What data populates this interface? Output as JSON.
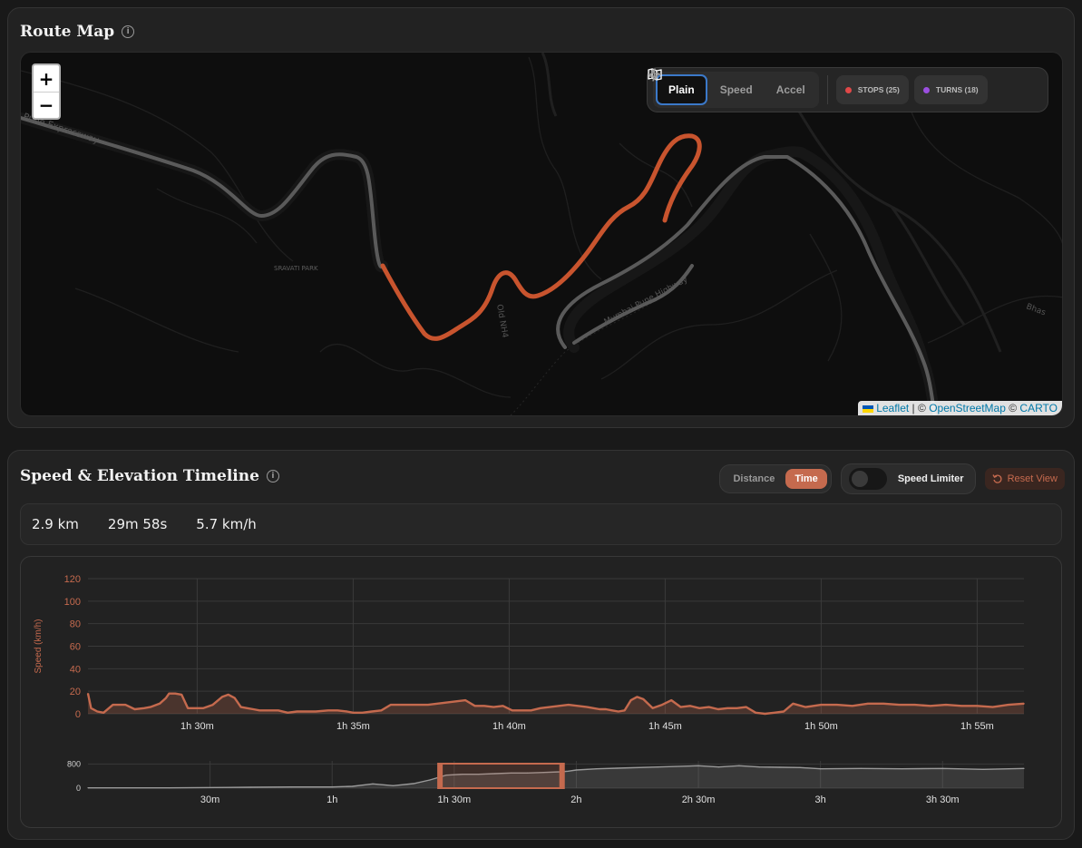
{
  "route_map": {
    "title": "Route Map",
    "info_icon": "info-icon",
    "zoom_in": "+",
    "zoom_out": "−",
    "modes": [
      {
        "label": "Plain",
        "icon": "map-icon",
        "active": true
      },
      {
        "label": "Speed",
        "icon": "lightning-icon",
        "active": false
      },
      {
        "label": "Accel",
        "icon": "activity-icon",
        "active": false
      }
    ],
    "overlays": [
      {
        "label": "STOPS (25)",
        "color": "#e04848"
      },
      {
        "label": "TURNS (18)",
        "color": "#9b4fe0"
      }
    ],
    "map_labels": [
      "Pune Expressway",
      "SRAVATI PARK",
      "Old NH4",
      "Mumbai Pune Highway",
      "Bhas"
    ],
    "attribution": {
      "leaflet": "Leaflet",
      "sep1": " | © ",
      "osm": "OpenStreetMap",
      "sep2": " © ",
      "carto": "CARTO"
    },
    "colors": {
      "route": "#c8542e",
      "road": "#6a6a6a",
      "background": "#0e0e0e"
    }
  },
  "timeline": {
    "title": "Speed & Elevation Timeline",
    "axis_toggle": {
      "options": [
        "Distance",
        "Time"
      ],
      "selected": "Time"
    },
    "speed_limiter_label": "Speed Limiter",
    "speed_limiter_on": false,
    "reset_label": "Reset View",
    "stats": {
      "distance": "2.9 km",
      "duration": "29m 58s",
      "avg_speed": "5.7 km/h"
    }
  },
  "chart_data": [
    {
      "type": "area",
      "ylabel": "Speed (km/h)",
      "ylim": [
        0,
        120
      ],
      "yticks": [
        0,
        20,
        40,
        60,
        80,
        100,
        120
      ],
      "xlim_minutes": [
        86.5,
        116.5
      ],
      "xticks_minutes": [
        90,
        95,
        100,
        105,
        110,
        115
      ],
      "xtick_labels": [
        "1h 30m",
        "1h 35m",
        "1h 40m",
        "1h 45m",
        "1h 50m",
        "1h 55m"
      ],
      "grid": true,
      "color": "#c56a4e",
      "series": [
        {
          "x_minutes": [
            86.5,
            86.6,
            86.8,
            87.0,
            87.3,
            87.5,
            87.7,
            88.0,
            88.3,
            88.5,
            88.8,
            89.0,
            89.1,
            89.3,
            89.5,
            89.7,
            89.9,
            90.2,
            90.5,
            90.8,
            91.0,
            91.2,
            91.4,
            91.6,
            91.8,
            92.0,
            92.3,
            92.6,
            92.9,
            93.2,
            93.5,
            93.8,
            94.2,
            94.5,
            94.8,
            95.0,
            95.3,
            95.6,
            95.9,
            96.2,
            96.5,
            96.8,
            97.1,
            97.4,
            97.7,
            98.0,
            98.3,
            98.6,
            98.9,
            99.2,
            99.5,
            99.8,
            100.1,
            100.4,
            100.7,
            101.0,
            101.3,
            101.6,
            101.9,
            102.2,
            102.5,
            102.7,
            102.9,
            103.1,
            103.3,
            103.5,
            103.7,
            103.9,
            104.1,
            104.3,
            104.6,
            104.9,
            105.2,
            105.5,
            105.8,
            106.1,
            106.4,
            106.7,
            107.0,
            107.3,
            107.6,
            107.9,
            108.2,
            108.5,
            108.8,
            109.1,
            109.5,
            110.0,
            110.5,
            111.0,
            111.5,
            112.0,
            112.5,
            113.0,
            113.5,
            114.0,
            114.5,
            115.0,
            115.5,
            116.0,
            116.5
          ],
          "values": [
            18,
            5,
            2,
            1,
            8,
            8,
            8,
            4,
            5,
            6,
            9,
            14,
            18,
            18,
            17,
            5,
            5,
            5,
            8,
            15,
            17,
            14,
            6,
            5,
            4,
            3,
            3,
            3,
            1,
            2,
            2,
            2,
            3,
            3,
            2,
            1,
            1,
            2,
            3,
            8,
            8,
            8,
            8,
            8,
            9,
            10,
            11,
            12,
            7,
            7,
            6,
            7,
            3,
            3,
            3,
            5,
            6,
            7,
            8,
            7,
            6,
            5,
            4,
            4,
            3,
            2,
            3,
            12,
            15,
            13,
            5,
            8,
            12,
            6,
            7,
            5,
            6,
            4,
            5,
            5,
            6,
            1,
            0,
            1,
            2,
            9,
            6,
            8,
            8,
            7,
            9,
            9,
            8,
            8,
            7,
            8,
            7,
            7,
            6,
            8,
            9
          ]
        }
      ]
    },
    {
      "type": "area",
      "ylabel": "",
      "ylim": [
        0,
        900
      ],
      "yticks": [
        0,
        800
      ],
      "xlim_minutes": [
        0,
        230
      ],
      "xticks_minutes": [
        30,
        60,
        90,
        120,
        150,
        180,
        210
      ],
      "xtick_labels": [
        "30m",
        "1h",
        "1h 30m",
        "2h",
        "2h 30m",
        "3h",
        "3h 30m"
      ],
      "selection_minutes": [
        86.5,
        116.5
      ],
      "color": "#9a9a9a",
      "series": [
        {
          "x_minutes": [
            0,
            20,
            40,
            50,
            60,
            65,
            70,
            75,
            80,
            84,
            88,
            92,
            96,
            100,
            104,
            108,
            112,
            116,
            118,
            120,
            125,
            130,
            140,
            150,
            155,
            160,
            165,
            170,
            175,
            180,
            190,
            200,
            210,
            220,
            230
          ],
          "values": [
            10,
            10,
            30,
            40,
            40,
            60,
            140,
            80,
            150,
            270,
            430,
            460,
            460,
            480,
            500,
            500,
            520,
            540,
            560,
            600,
            640,
            660,
            700,
            740,
            700,
            740,
            700,
            690,
            680,
            640,
            650,
            640,
            650,
            620,
            650
          ]
        }
      ]
    }
  ]
}
